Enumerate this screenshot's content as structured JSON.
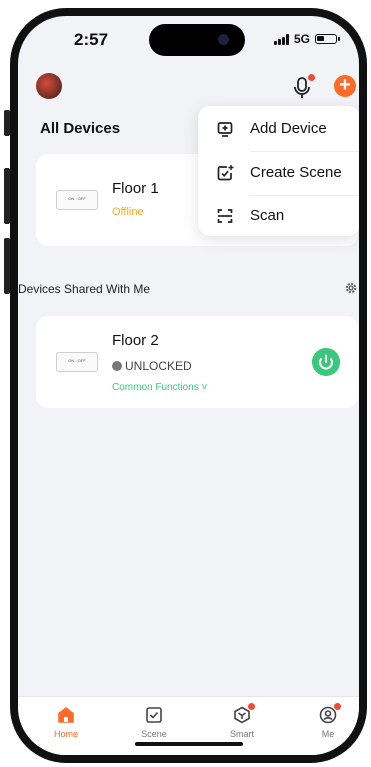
{
  "status_bar": {
    "time": "2:57",
    "network": "5G"
  },
  "header": {
    "section_title": "All Devices"
  },
  "add_menu": {
    "items": [
      {
        "label": "Add Device",
        "icon": "add-device-icon"
      },
      {
        "label": "Create Scene",
        "icon": "create-scene-icon"
      },
      {
        "label": "Scan",
        "icon": "scan-icon"
      }
    ]
  },
  "devices": [
    {
      "name": "Floor 1",
      "status": "Offline",
      "device_label": "ON · OFF"
    }
  ],
  "shared": {
    "title": "Devices Shared With Me",
    "devices": [
      {
        "name": "Floor 2",
        "status": "UNLOCKED",
        "action": "Common Functions",
        "device_label": "ON · OFF"
      }
    ]
  },
  "tabs": [
    {
      "label": "Home",
      "icon": "home-icon",
      "active": true
    },
    {
      "label": "Scene",
      "icon": "scene-icon"
    },
    {
      "label": "Smart",
      "icon": "smart-icon"
    },
    {
      "label": "Me",
      "icon": "me-icon"
    }
  ],
  "colors": {
    "accent": "#ff6a2b",
    "green": "#3cc87c",
    "offline": "#f5a623",
    "badge": "#f04a3a"
  }
}
